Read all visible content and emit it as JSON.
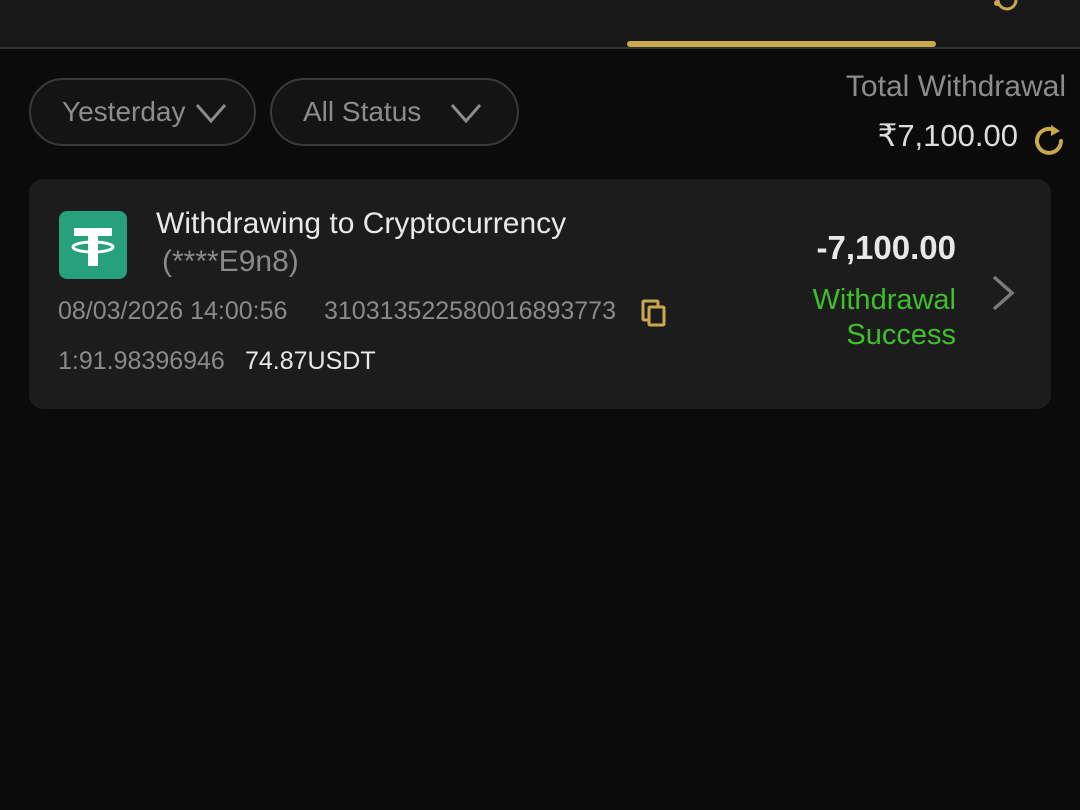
{
  "filters": {
    "date_label": "Yesterday",
    "status_label": "All Status"
  },
  "summary": {
    "total_label": "Total Withdrawal",
    "total_amount": "₹7,100.00"
  },
  "transaction": {
    "icon": "usdt-tether-icon",
    "title": "Withdrawing to Cryptocurrency",
    "account": "(****E9n8)",
    "datetime": "08/03/2026 14:00:56",
    "order_id": "310313522580016893773",
    "rate": "1:91.98396946",
    "usdt_amount": "74.87USDT",
    "amount": "-7,100.00",
    "status": "Withdrawal Success"
  },
  "colors": {
    "accent": "#c9a84e",
    "success": "#3fbf2c",
    "usdt": "#26a17b",
    "background": "#0b0b0b",
    "card": "#1c1c1c"
  }
}
